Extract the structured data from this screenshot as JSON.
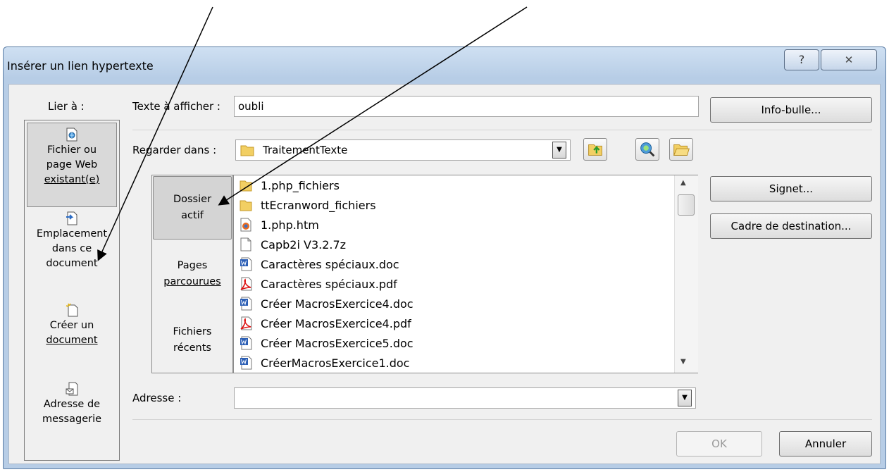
{
  "dialog": {
    "title": "Insérer un lien hypertexte",
    "help_symbol": "?",
    "close_symbol": "✕"
  },
  "link_to": {
    "label": "Lier à :",
    "items": [
      {
        "line1": "Fichier ou",
        "line2": "page Web",
        "line3": "existant(e)",
        "icon": "file-web-icon",
        "selected": true
      },
      {
        "line1": "Emplacement",
        "line2": "dans ce",
        "line3": "document",
        "icon": "place-in-document-icon",
        "selected": false
      },
      {
        "line1": "Créer un",
        "line2": "document",
        "icon": "new-document-icon",
        "selected": false
      },
      {
        "line1": "Adresse de",
        "line2": "messagerie",
        "icon": "email-address-icon",
        "selected": false
      }
    ]
  },
  "text_to_display": {
    "label": "Texte à afficher :",
    "value": "oubli"
  },
  "look_in": {
    "label": "Regarder dans :",
    "value": "TraitementTexte"
  },
  "nav": [
    {
      "line1": "Dossier",
      "line2": "actif",
      "selected": true
    },
    {
      "line1": "Pages",
      "line2": "parcourues",
      "selected": false
    },
    {
      "line1": "Fichiers",
      "line2": "récents",
      "selected": false
    }
  ],
  "files": [
    {
      "name": "1.php_fichiers",
      "type": "folder"
    },
    {
      "name": "ttEcranword_fichiers",
      "type": "folder"
    },
    {
      "name": "1.php.htm",
      "type": "firefox"
    },
    {
      "name": "Capb2i V3.2.7z",
      "type": "blank"
    },
    {
      "name": "Caractères spéciaux.doc",
      "type": "word"
    },
    {
      "name": "Caractères spéciaux.pdf",
      "type": "pdf"
    },
    {
      "name": "Créer MacrosExercice4.doc",
      "type": "word"
    },
    {
      "name": "Créer MacrosExercice4.pdf",
      "type": "pdf"
    },
    {
      "name": "Créer MacrosExercice5.doc",
      "type": "word"
    },
    {
      "name": "CréerMacrosExercice1.doc",
      "type": "word"
    }
  ],
  "address": {
    "label": "Adresse :",
    "value": ""
  },
  "buttons": {
    "screentip": "Info-bulle...",
    "bookmark": "Signet...",
    "target_frame": "Cadre de destination...",
    "ok": "OK",
    "cancel": "Annuler"
  },
  "colors": {
    "title_bar": "#b7cde6",
    "client_bg": "#f0f0f0",
    "selected_bg": "#d9d9d9"
  }
}
